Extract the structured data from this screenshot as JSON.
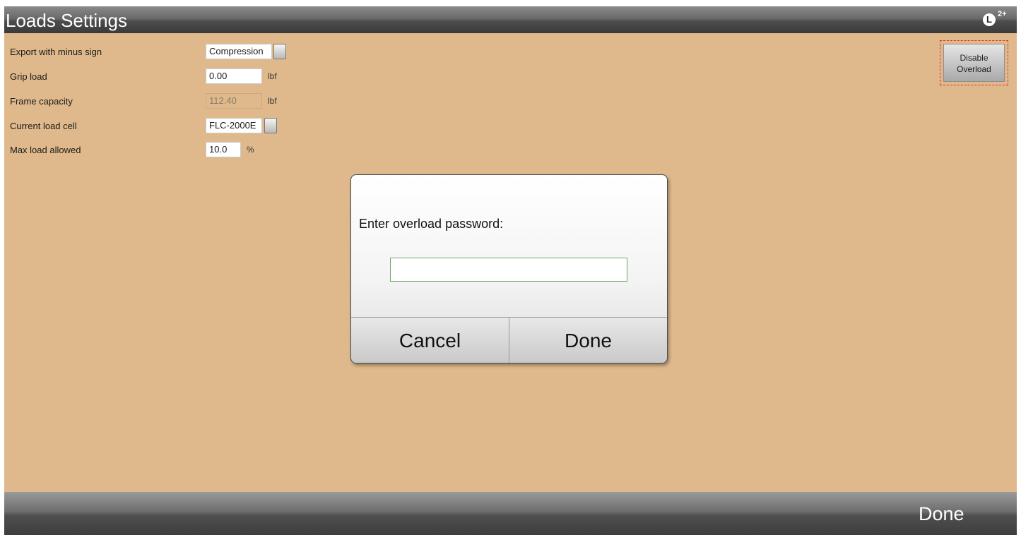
{
  "header": {
    "title": "Loads Settings",
    "level_badge": "L",
    "level_suffix": "2+"
  },
  "settings": {
    "export_minus": {
      "label": "Export with minus sign",
      "value": "Compression"
    },
    "grip_load": {
      "label": "Grip load",
      "value": "0.00",
      "unit": "lbf"
    },
    "frame_capacity": {
      "label": "Frame capacity",
      "value": "112.40",
      "unit": "lbf"
    },
    "current_load_cell": {
      "label": "Current load cell",
      "value": "FLC-2000E"
    },
    "max_load": {
      "label": "Max load allowed",
      "value": "10.0",
      "unit": "%"
    }
  },
  "overload_button": {
    "line1": "Disable",
    "line2": "Overload"
  },
  "dialog": {
    "prompt": "Enter overload password:",
    "password_value": "",
    "cancel_label": "Cancel",
    "done_label": "Done"
  },
  "footer": {
    "done_label": "Done"
  },
  "colors": {
    "background": "#dfb98b",
    "input_focus_border": "#6aa868",
    "overload_border": "#e03030"
  }
}
